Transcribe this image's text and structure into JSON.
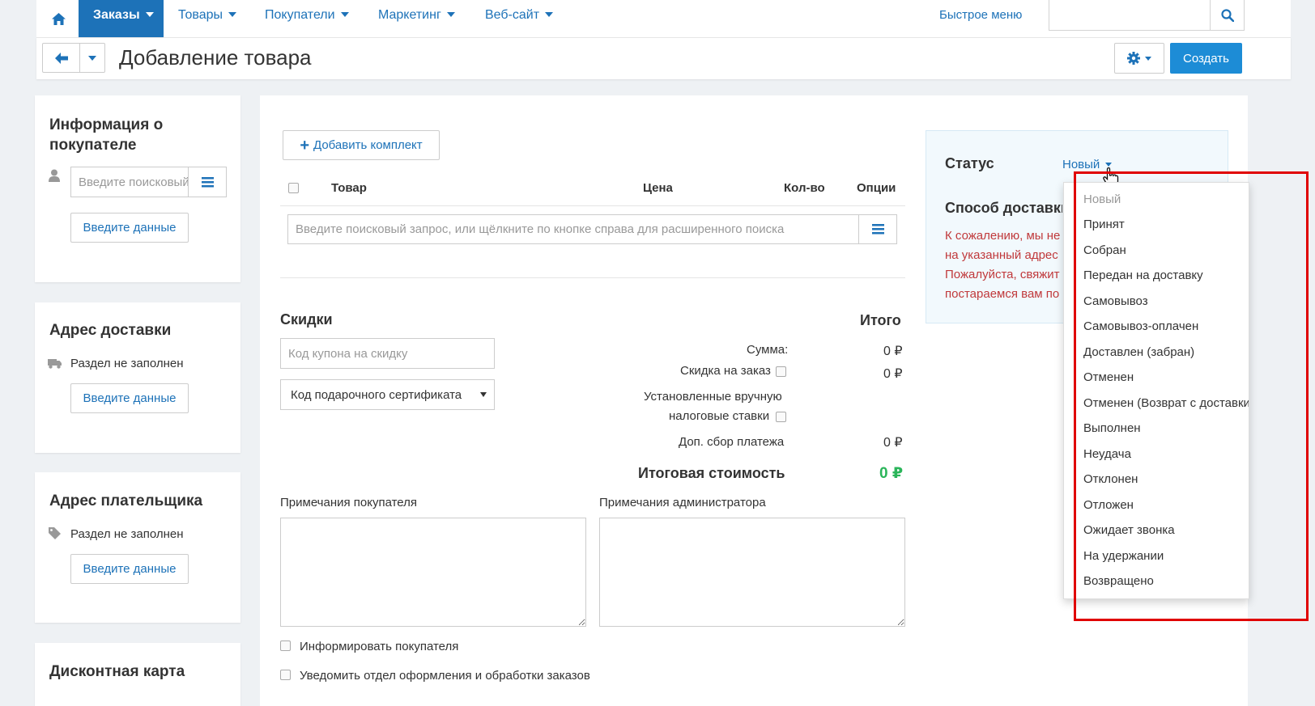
{
  "nav": {
    "items": [
      "Заказы",
      "Товары",
      "Покупатели",
      "Маркетинг",
      "Веб-сайт"
    ],
    "quick_menu": "Быстрое меню",
    "search_placeholder": ""
  },
  "toolbar": {
    "title": "Добавление товара",
    "create_label": "Создать"
  },
  "sidebar": {
    "customer": {
      "title_line1": "Информация о",
      "title_line2": "покупателе",
      "search_placeholder": "Введите поисковый запрос",
      "button": "Введите данные"
    },
    "shipping": {
      "title": "Адрес доставки",
      "empty": "Раздел не заполнен",
      "button": "Введите данные"
    },
    "payer": {
      "title": "Адрес плательщика",
      "empty": "Раздел не заполнен",
      "button": "Введите данные"
    },
    "discount_card": {
      "title": "Дисконтная карта"
    }
  },
  "main": {
    "add_kit": "Добавить комплект",
    "columns": [
      "Товар",
      "Цена",
      "Кол-во",
      "Опции"
    ],
    "product_search_placeholder": "Введите поисковый запрос, или щёлкните по кнопке справа для расширенного поиска",
    "discounts_title": "Скидки",
    "coupon_placeholder": "Код купона на скидку",
    "gift_cert": "Код подарочного сертификата",
    "total_title": "Итого",
    "sum_label": "Сумма:",
    "sum_value": "0 ₽",
    "order_discount_label": "Скидка на заказ",
    "order_discount_value": "0 ₽",
    "manual_tax_line1": "Установленные вручную",
    "manual_tax_line2": "налоговые ставки",
    "payment_fee_label": "Доп. сбор платежа",
    "payment_fee_value": "0 ₽",
    "grand_total_label": "Итоговая стоимость",
    "grand_total_value": "0 ₽",
    "customer_notes": "Примечания покупателя",
    "admin_notes": "Примечания администратора",
    "notify_customer": "Информировать покупателя",
    "notify_dept": "Уведомить отдел оформления и обработки заказов"
  },
  "status": {
    "label": "Статус",
    "current": "Новый",
    "shipping_label": "Способ доставки",
    "warning_lines": [
      "К сожалению, мы не",
      "на указанный адрес",
      "Пожалуйста, свяжит",
      "постараемся вам по"
    ],
    "options": [
      "Новый",
      "Принят",
      "Собран",
      "Передан на доставку",
      "Самовывоз",
      "Самовывоз-оплачен",
      "Доставлен (забран)",
      "Отменен",
      "Отменен (Возврат с доставки)",
      "Выполнен",
      "Неудача",
      "Отклонен",
      "Отложен",
      "Ожидает звонка",
      "На удержании",
      "Возвращено"
    ]
  },
  "colors": {
    "primary": "#1d72b8",
    "create_button": "#1d8cd6",
    "total_green": "#2bb55a",
    "warning_red": "#c0393b",
    "highlight_red": "#e00000"
  }
}
